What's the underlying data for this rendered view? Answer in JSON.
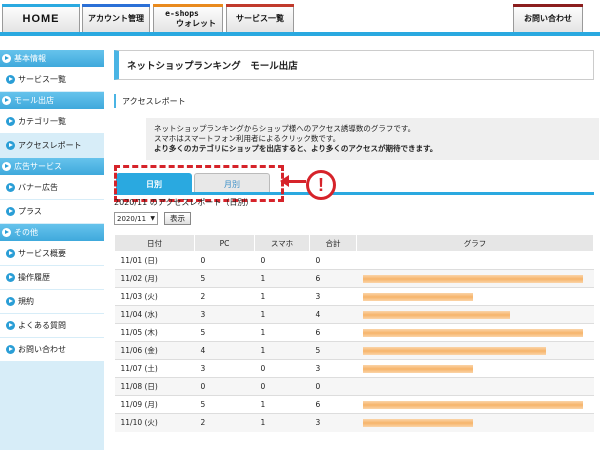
{
  "nav": {
    "home": "HOME",
    "account": "アカウント管理",
    "eshops_top": "e-shops",
    "eshops_sub": "ウォレット",
    "service": "サービス一覧",
    "contact": "お問い合わせ"
  },
  "sidebar": {
    "sections": [
      {
        "title": "基本情報",
        "items": [
          "サービス一覧"
        ]
      },
      {
        "title": "モール出店",
        "items": [
          "カテゴリ一覧",
          "アクセスレポート"
        ]
      },
      {
        "title": "広告サービス",
        "items": [
          "バナー広告",
          "プラス"
        ]
      },
      {
        "title": "その他",
        "items": [
          "サービス概要",
          "操作履歴",
          "規約",
          "よくある質問",
          "お問い合わせ"
        ]
      }
    ],
    "active_item": "アクセスレポート"
  },
  "page": {
    "title": "ネットショップランキング　モール出店",
    "section_title": "アクセスレポート",
    "desc_line1": "ネットショップランキングからショップ様へのアクセス誘導数のグラフです。",
    "desc_line2": "スマホはスマートフォン利用者によるクリック数です。",
    "desc_line3": "より多くのカテゴリにショップを出店すると、より多くのアクセスが期待できます。"
  },
  "tabs": {
    "day": "日別",
    "month": "月別"
  },
  "callout": {
    "mark": "!"
  },
  "report": {
    "title": "2020/11 のアクセスレポート（日別）",
    "selected_month": "2020/11",
    "show_button": "表示"
  },
  "table": {
    "headers": [
      "日付",
      "PC",
      "スマホ",
      "合計",
      "グラフ"
    ],
    "max_total": 6
  },
  "chart_data": {
    "type": "table",
    "columns": [
      "日付",
      "PC",
      "スマホ",
      "合計"
    ],
    "rows": [
      [
        "11/01 (日)",
        0,
        0,
        0
      ],
      [
        "11/02 (月)",
        5,
        1,
        6
      ],
      [
        "11/03 (火)",
        2,
        1,
        3
      ],
      [
        "11/04 (水)",
        3,
        1,
        4
      ],
      [
        "11/05 (木)",
        5,
        1,
        6
      ],
      [
        "11/06 (金)",
        4,
        1,
        5
      ],
      [
        "11/07 (土)",
        3,
        0,
        3
      ],
      [
        "11/08 (日)",
        0,
        0,
        0
      ],
      [
        "11/09 (月)",
        5,
        1,
        6
      ],
      [
        "11/10 (火)",
        2,
        1,
        3
      ]
    ]
  },
  "colors": {
    "accent": "#2aa9e0",
    "alert": "#d6232a",
    "bar": "#f6b46a"
  }
}
